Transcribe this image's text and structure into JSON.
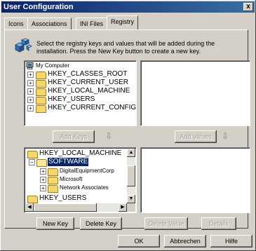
{
  "window": {
    "title": "User Configuration",
    "close_glyph": "x"
  },
  "tabs": [
    {
      "label": "Icons",
      "active": false
    },
    {
      "label": "Associations",
      "active": false
    },
    {
      "label": "INI Files",
      "active": false
    },
    {
      "label": "Registry",
      "active": true
    }
  ],
  "description": "Select the registry keys and values that will be added during the installation. Press the New Key button to create a new key.",
  "source_tree": {
    "root": "My Computer",
    "items": [
      "HKEY_CLASSES_ROOT",
      "HKEY_CURRENT_USER",
      "HKEY_LOCAL_MACHINE",
      "HKEY_USERS",
      "HKEY_CURRENT_CONFIG"
    ]
  },
  "add_keys_label": "Add Keys",
  "add_values_label": "Add Values",
  "dest_tree": {
    "root": "HKEY_LOCAL_MACHINE",
    "selected": "SOFTWARE",
    "children": [
      "DigitalEquipmentCorp",
      "Microsoft",
      "Network Associates"
    ],
    "next_root": "HKEY_USERS"
  },
  "buttons": {
    "new_key": "New Key",
    "delete_key": "Delete Key",
    "delete_value": "Delete Value",
    "details": "Details",
    "ok": "OK",
    "cancel": "Abbrechen",
    "help": "Hilfe"
  },
  "icons": {
    "expand": "plus-box-icon",
    "collapse": "minus-box-icon",
    "folder": "folder-icon",
    "computer": "computer-icon",
    "down_arrow": "down-arrow-icon"
  }
}
